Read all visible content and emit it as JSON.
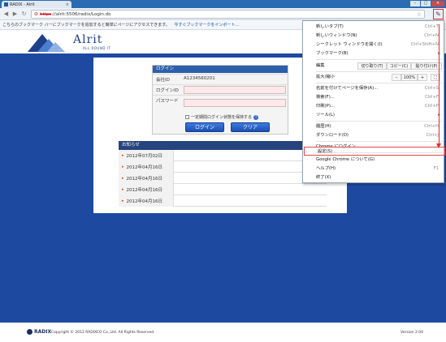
{
  "browser": {
    "tab_title": "RADIX - Alrit",
    "tab_close": "×",
    "url_https": "https",
    "url_rest": "://alrit:5506/radix/Login.do",
    "bookmark_bar_text": "こちらのブックマーク バーにブックマークを追加すると簡単にページにアクセスできます。",
    "bookmark_bar_link": "今すぐブックマークをインポート...",
    "window_buttons": [
      "–",
      "□",
      "×"
    ],
    "nav": [
      "◀",
      "▶",
      "↻"
    ]
  },
  "header": {
    "logo_text": "Alrit",
    "logo_tagline": "ALL ROUND IT"
  },
  "login": {
    "title": "ログイン",
    "company_label": "会社ID",
    "company_value": "A1234560201",
    "login_id_label": "ログインID",
    "password_label": "パスワード",
    "remember_label": "一定期間ログイン状態を保持する",
    "help_glyph": "?",
    "login_button": "ログイン",
    "clear_button": "クリア"
  },
  "notice": {
    "title": "お知らせ",
    "rows": [
      {
        "date": "2012年07月02日",
        "text": ""
      },
      {
        "date": "2012年04月16日",
        "text": ""
      },
      {
        "date": "2012年04月16日",
        "text": ""
      },
      {
        "date": "2012年04月16日",
        "text": ""
      },
      {
        "date": "2012年04月16日",
        "text": ""
      }
    ],
    "arrow": "▸"
  },
  "footer": {
    "brand": "RADIX",
    "copyright": "Copyright © 2012 RADIXCO Co.,Ltd. All Rights Reserved.",
    "version": "Version 2.04"
  },
  "menu": {
    "items": [
      {
        "label": "新しいタブ(T)",
        "shortcut": "Ctrl+T"
      },
      {
        "label": "新しいウィンドウ(N)",
        "shortcut": "Ctrl+N"
      },
      {
        "label": "シークレット ウィンドウを開く(I)",
        "shortcut": "Ctrl+Shift+N"
      },
      {
        "label": "ブックマーク(B)",
        "shortcut": ""
      },
      {
        "label": "編集",
        "shortcut": ""
      },
      {
        "label": "拡大/縮小",
        "shortcut": ""
      },
      {
        "label": "名前を付けてページを保存(A)...",
        "shortcut": "Ctrl+S"
      },
      {
        "label": "検索(F)...",
        "shortcut": "Ctrl+F"
      },
      {
        "label": "印刷(P)...",
        "shortcut": "Ctrl+P"
      },
      {
        "label": "ツール(L)",
        "shortcut": ""
      },
      {
        "label": "履歴(H)",
        "shortcut": "Ctrl+H"
      },
      {
        "label": "ダウンロード(D)",
        "shortcut": "Ctrl+J"
      },
      {
        "label": "Chrome にログイン...",
        "shortcut": ""
      },
      {
        "label": "設定(S)",
        "shortcut": ""
      },
      {
        "label": "Google Chrome について(G)",
        "shortcut": ""
      },
      {
        "label": "ヘルプ(H)",
        "shortcut": "F1"
      },
      {
        "label": "終了(X)",
        "shortcut": ""
      }
    ],
    "edit_cut": "切り取り(T)",
    "edit_copy": "コピー(C)",
    "edit_paste": "貼り付け(P)",
    "zoom_minus": "–",
    "zoom_value": "100%",
    "zoom_plus": "+",
    "fullscreen": "⛶",
    "submenu_arrow": "▸"
  }
}
